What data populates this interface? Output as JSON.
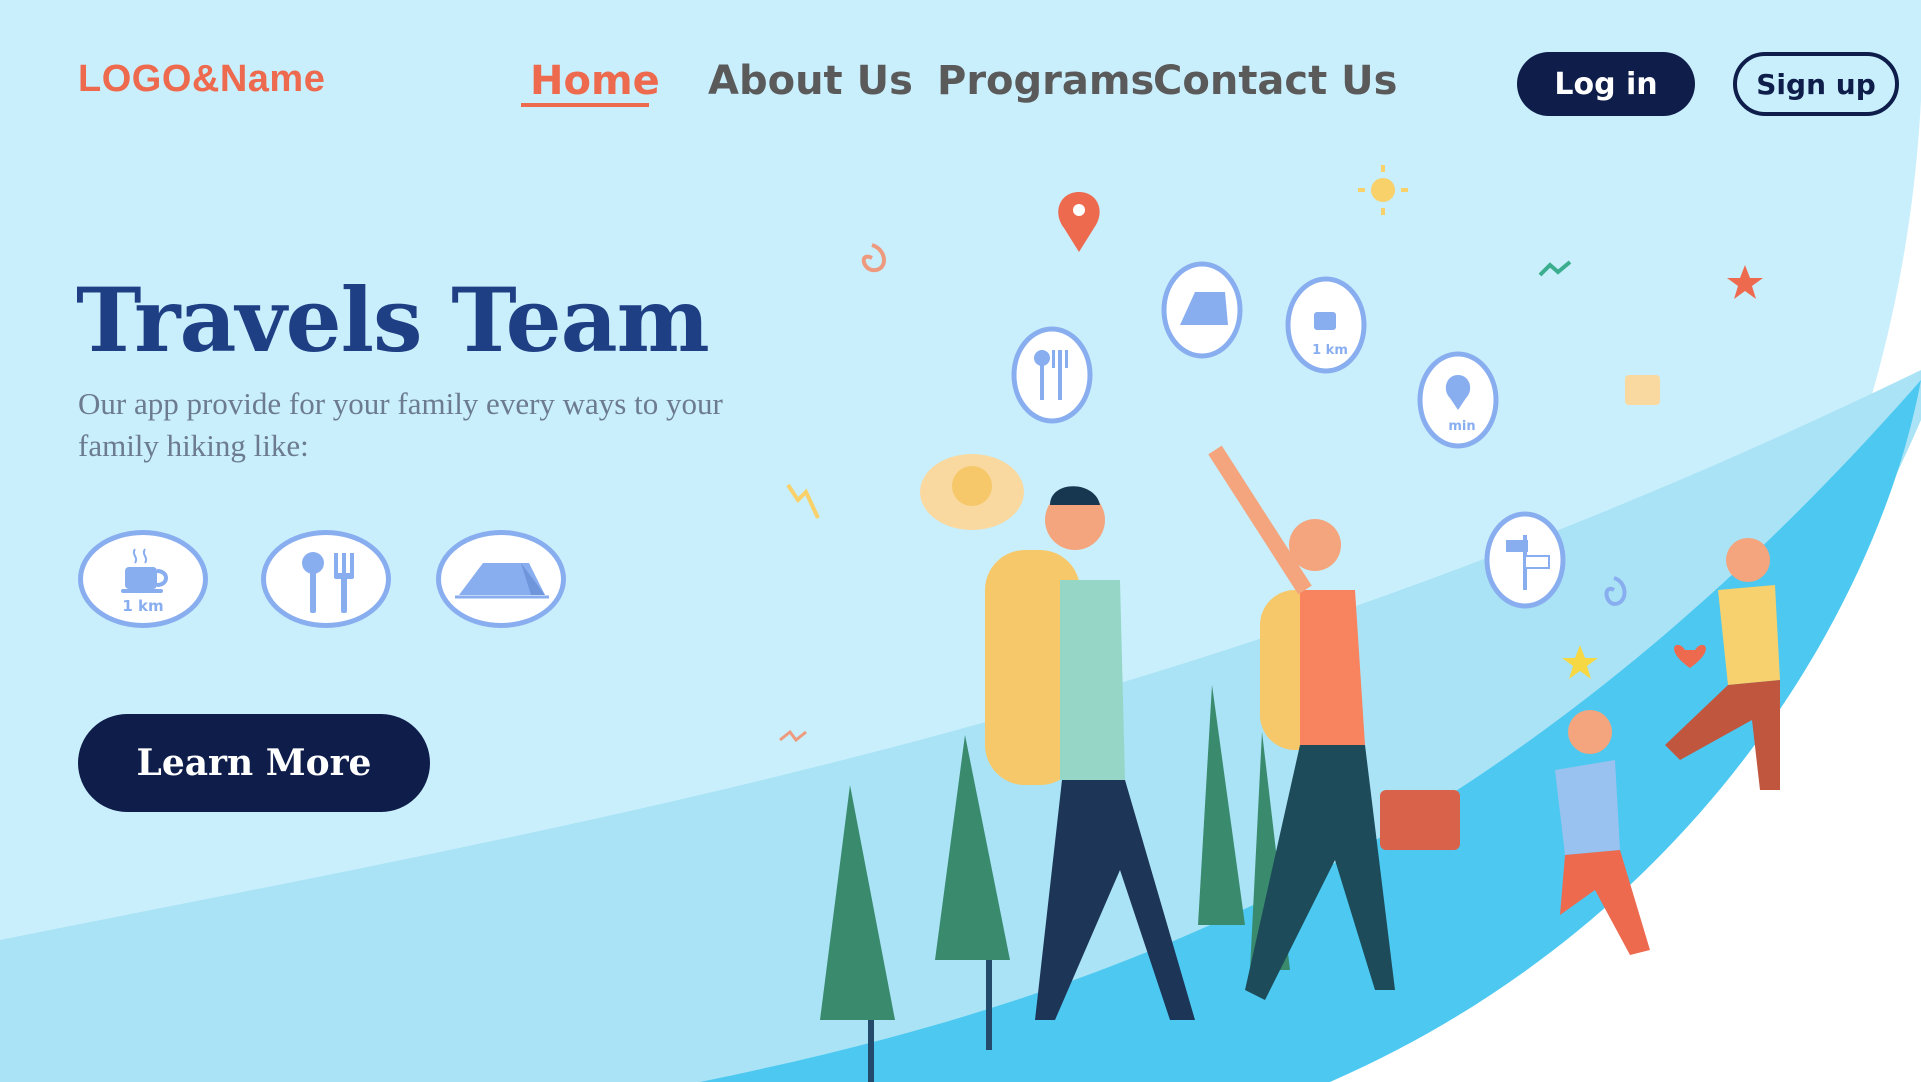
{
  "brand": {
    "logo_text": "LOGO&Name"
  },
  "nav": {
    "items": [
      {
        "label": "Home",
        "active": true
      },
      {
        "label": "About Us",
        "active": false
      },
      {
        "label": "Programs",
        "active": false
      },
      {
        "label": "Contact Us",
        "active": false
      }
    ],
    "login_label": "Log in",
    "signup_label": "Sign up"
  },
  "hero": {
    "title": "Travels Team",
    "description": "Our  app provide for your family every ways to your family hiking like:",
    "features": [
      {
        "icon": "coffee-cup-icon",
        "caption": "1 km"
      },
      {
        "icon": "spoon-fork-icon"
      },
      {
        "icon": "tent-icon"
      }
    ],
    "cta_label": "Learn More"
  },
  "illustration": {
    "bubbles": [
      {
        "icon": "spoon-fork-icon"
      },
      {
        "icon": "tent-icon"
      },
      {
        "icon": "coffee-cup-icon",
        "caption": "1 km"
      },
      {
        "icon": "map-pin-icon",
        "caption": "min"
      },
      {
        "icon": "signpost-icon"
      }
    ]
  },
  "colors": {
    "accent": "#ee6a4f",
    "navy": "#0f1d4a",
    "title_blue": "#1f3f85",
    "sky": "#c9effc",
    "ground": "#4cc8f1",
    "icon_blue": "#89aef0"
  }
}
